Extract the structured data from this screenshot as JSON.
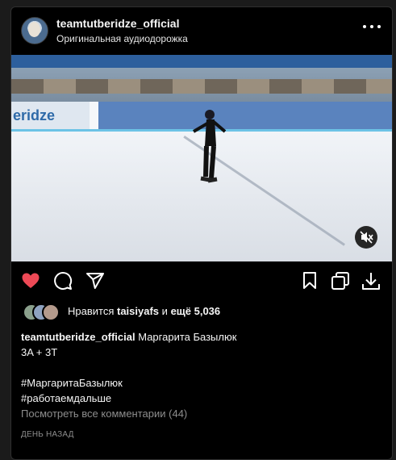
{
  "post": {
    "username": "teamtutberidze_official",
    "audio": "Оригинальная аудиодорожка",
    "video": {
      "banner_text": "eridze"
    },
    "likes": {
      "prefix": "Нравится",
      "user": "taisiyafs",
      "and": "и",
      "rest": "ещё 5,036"
    },
    "caption": {
      "author": "teamtutberidze_official",
      "title": "Маргарита Базылюк",
      "line2": "3A + 3T",
      "hashtag1": "#МаргаритаБазылюк",
      "hashtag2": "#работаемдальше"
    },
    "comments_link": "Посмотреть все комментарии (44)",
    "timestamp": "ДЕНЬ НАЗАД"
  },
  "icons": {
    "more": "more-options-icon",
    "like": "heart-icon",
    "comment": "comment-icon",
    "share": "send-icon",
    "save": "bookmark-icon",
    "repost": "repost-icon",
    "download": "download-icon",
    "mute": "muted-speaker-icon"
  },
  "colors": {
    "like": "#ed4956",
    "muted_text": "#8e8e8e"
  }
}
